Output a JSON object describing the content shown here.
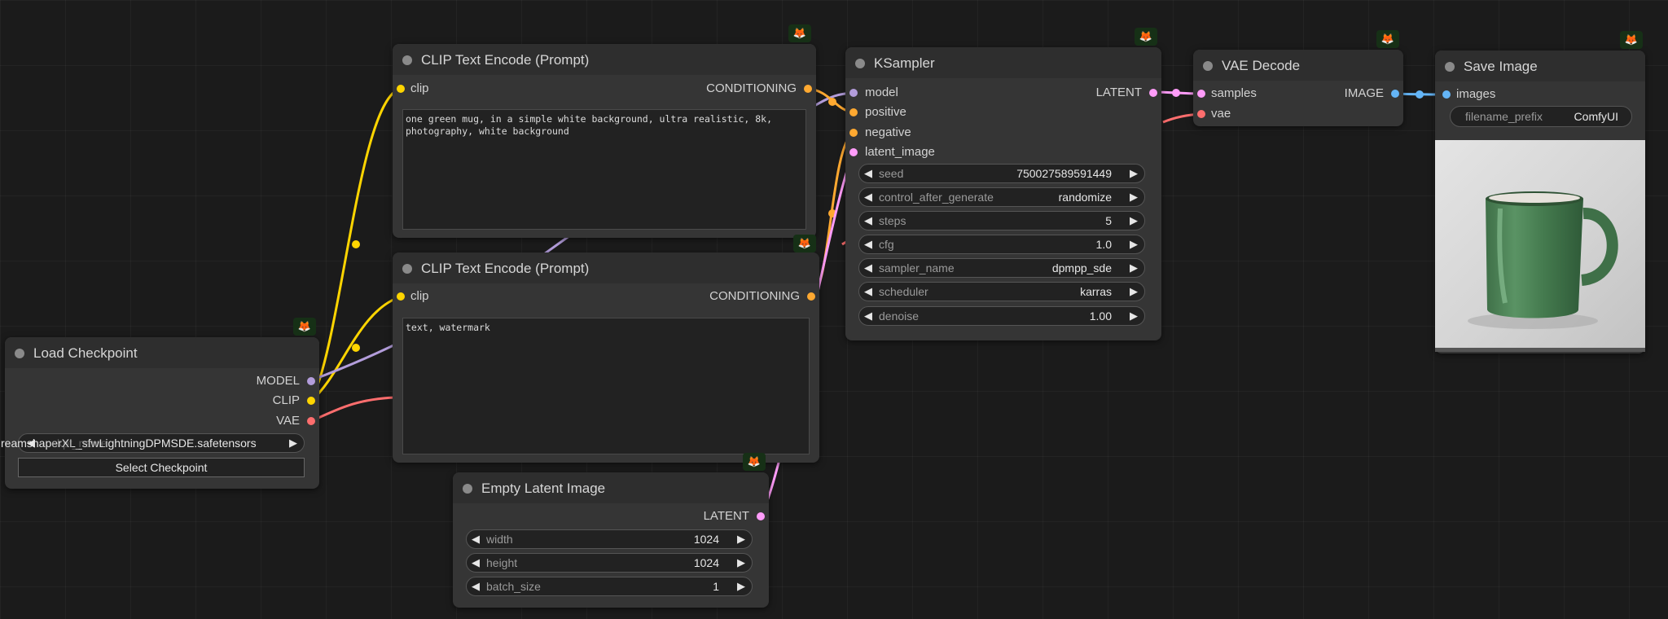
{
  "nodes": {
    "clip_pos": {
      "title": "CLIP Text Encode (Prompt)",
      "input": "clip",
      "output": "CONDITIONING",
      "text": "one green mug, in a simple white background, ultra realistic, 8k,\nphotography, white background"
    },
    "clip_neg": {
      "title": "CLIP Text Encode (Prompt)",
      "input": "clip",
      "output": "CONDITIONING",
      "text": "text, watermark"
    },
    "checkpoint": {
      "title": "Load Checkpoint",
      "outputs": [
        "MODEL",
        "CLIP",
        "VAE"
      ],
      "ckpt_name": "reamshaperXL_sfwLightningDPMSDE.safetensors",
      "ckpt_overlap": "ckpt_name",
      "button": "Select Checkpoint"
    },
    "latent": {
      "title": "Empty Latent Image",
      "output": "LATENT",
      "widgets": [
        {
          "label": "width",
          "value": "1024"
        },
        {
          "label": "height",
          "value": "1024"
        },
        {
          "label": "batch_size",
          "value": "1"
        }
      ]
    },
    "ksampler": {
      "title": "KSampler",
      "inputs": [
        "model",
        "positive",
        "negative",
        "latent_image"
      ],
      "output": "LATENT",
      "widgets": [
        {
          "label": "seed",
          "value": "750027589591449"
        },
        {
          "label": "control_after_generate",
          "value": "randomize"
        },
        {
          "label": "steps",
          "value": "5"
        },
        {
          "label": "cfg",
          "value": "1.0"
        },
        {
          "label": "sampler_name",
          "value": "dpmpp_sde"
        },
        {
          "label": "scheduler",
          "value": "karras"
        },
        {
          "label": "denoise",
          "value": "1.00"
        }
      ]
    },
    "vae_decode": {
      "title": "VAE Decode",
      "inputs": [
        "samples",
        "vae"
      ],
      "output": "IMAGE"
    },
    "save_image": {
      "title": "Save Image",
      "input": "images",
      "filename_label": "filename_prefix",
      "filename_value": "ComfyUI"
    }
  },
  "icons": {
    "badge": "fox-badge-icon",
    "arrow_left": "◀",
    "arrow_right": "▶"
  },
  "colors": {
    "clip": "#ffd500",
    "model": "#b39ddb",
    "vae": "#ff6e6e",
    "conditioning": "#ffa931",
    "latent": "#ff9cf9",
    "image": "#64b5f6",
    "badge_fg": "#ff8a1c"
  }
}
